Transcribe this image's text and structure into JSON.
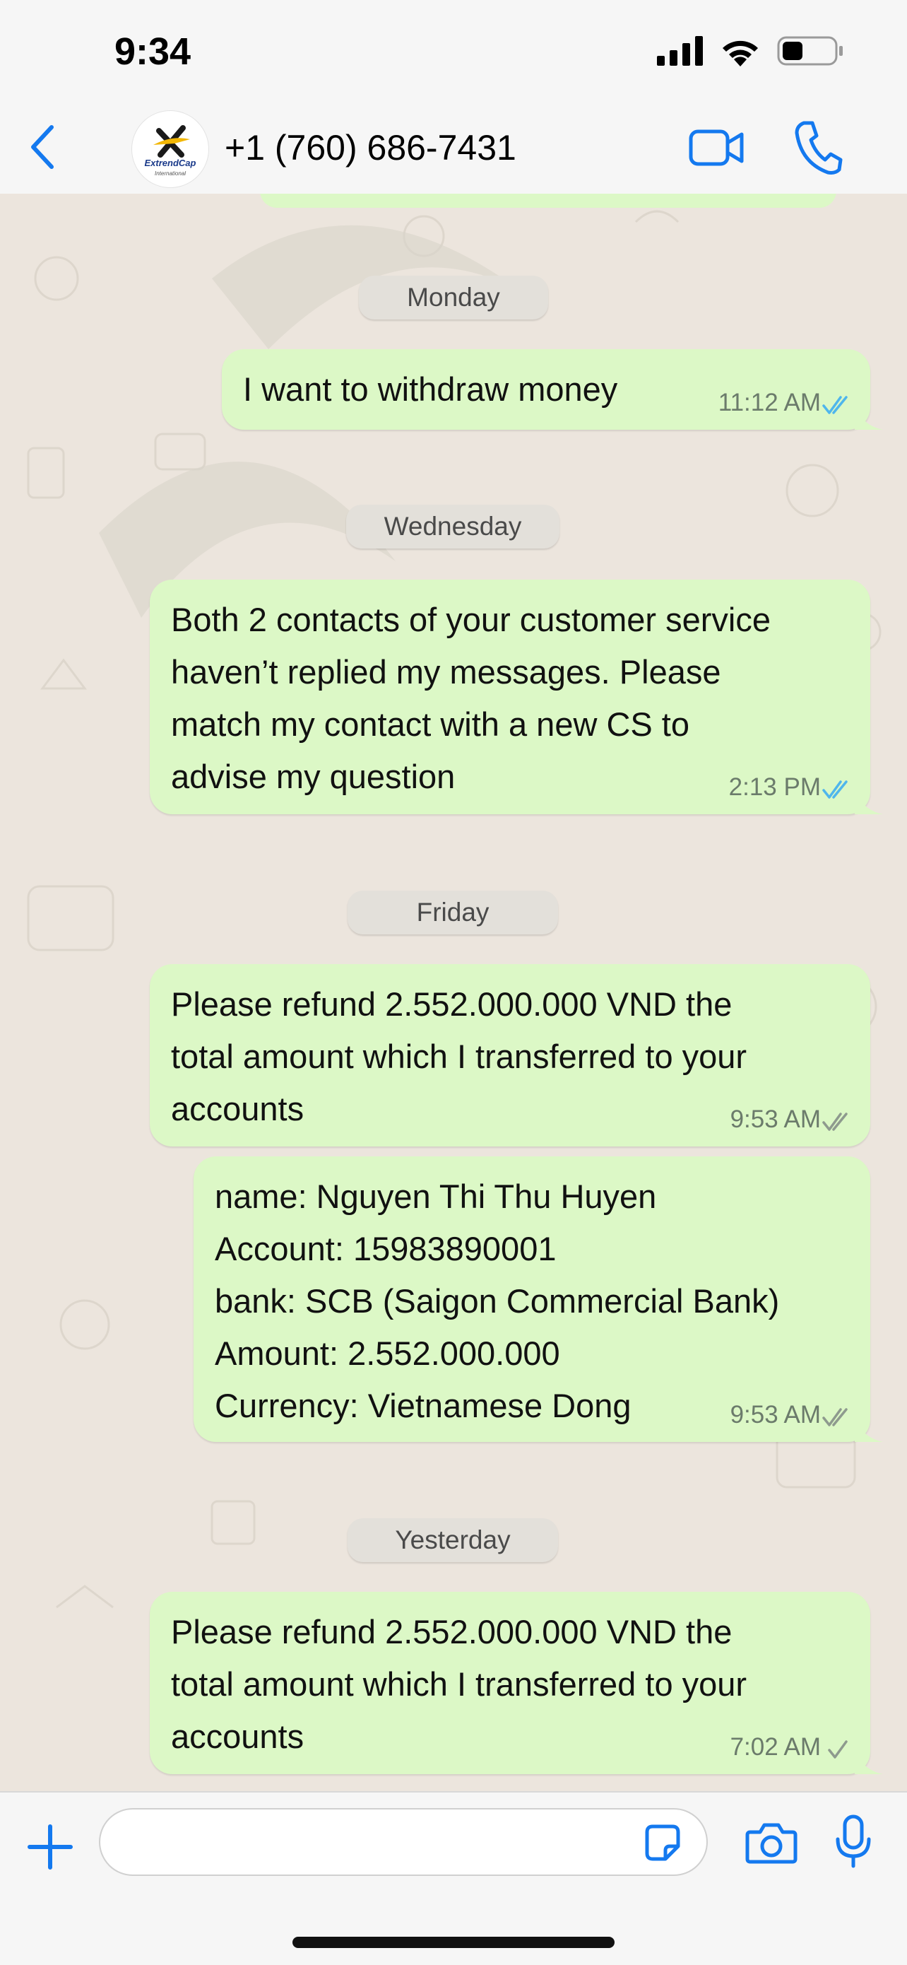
{
  "status_bar": {
    "time": "9:34",
    "icons": [
      "cellular-signal-icon",
      "wifi-icon",
      "battery-icon"
    ]
  },
  "header": {
    "contact_name": "+1 (760) 686-7431",
    "avatar_logo_text": "ExtrendCap",
    "avatar_logo_subtext": "International",
    "icons": [
      "chevron-left-icon",
      "video-camera-icon",
      "phone-icon"
    ]
  },
  "day_separators": [
    "Monday",
    "Wednesday",
    "Friday",
    "Yesterday"
  ],
  "messages": [
    {
      "text": "I want to withdraw money",
      "time": "11:12 AM",
      "status": "read"
    },
    {
      "text": "Both 2 contacts of your customer service\nhaven’t replied my messages. Please\nmatch my contact with a new CS to\nadvise my question",
      "time": "2:13 PM",
      "status": "read"
    },
    {
      "text": "Please refund 2.552.000.000 VND the\ntotal amount which I transferred to your\naccounts",
      "time": "9:53 AM",
      "status": "delivered"
    },
    {
      "text": "name: Nguyen Thi Thu Huyen\nAccount: 15983890001\nbank: SCB (Saigon Commercial Bank)\nAmount: 2.552.000.000\nCurrency: Vietnamese Dong",
      "time": "9:53 AM",
      "status": "delivered"
    },
    {
      "text": "Please refund 2.552.000.000 VND the\ntotal amount which I transferred to your\naccounts",
      "time": "7:02 AM",
      "status": "sent"
    }
  ],
  "composer": {
    "placeholder": "",
    "icons": [
      "plus-icon",
      "sticker-icon",
      "camera-icon",
      "microphone-icon"
    ]
  },
  "colors": {
    "accent": "#1479EF",
    "bubble_outgoing": "#DCF8C6",
    "chat_background": "#ECE5DD",
    "read_tick": "#4FB6EC",
    "unread_tick": "#8E9A8E"
  }
}
